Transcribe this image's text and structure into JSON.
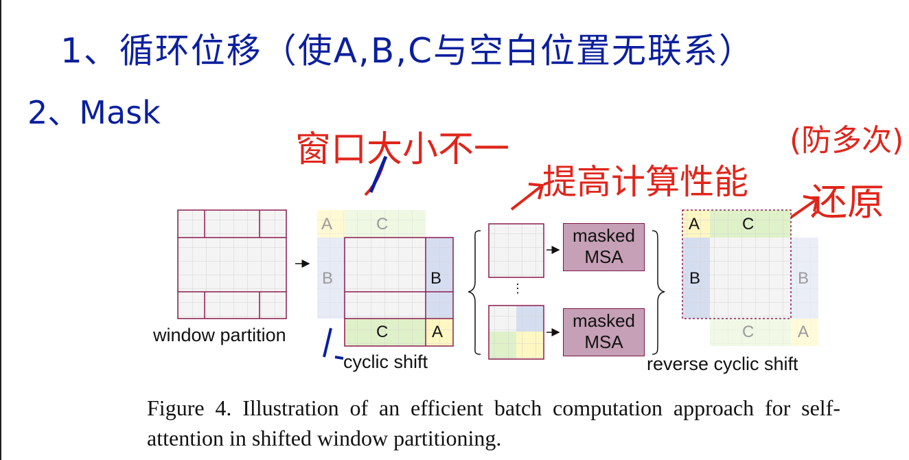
{
  "annotations": {
    "line1": "1、循环位移（使A,B,C与空白位置无联系）",
    "line2": "2、Mask",
    "window_size_note": "窗口大小不一",
    "performance_note": "提高计算性能",
    "prevent_note": "(防多次)",
    "restore_note": "还原"
  },
  "figure": {
    "window_partition_label": "window partition",
    "cyclic_shift_label": "cyclic shift",
    "reverse_cyclic_shift_label": "reverse cyclic shift",
    "letters": {
      "a": "A",
      "b": "B",
      "c": "C"
    },
    "msa_top_line1": "masked",
    "msa_top_line2": "MSA",
    "msa_bottom_line1": "masked",
    "msa_bottom_line2": "MSA",
    "vertical_dots": "⋮",
    "colors": {
      "grid_line": "#cfcfcf",
      "window_border": "#8a1a4f",
      "region_a": "#fff7c2",
      "region_b": "#d5def0",
      "region_c": "#dff1c8",
      "msa_fill": "#c6a0b6",
      "annotation_blue": "#0b1f9e",
      "annotation_red": "#e0251b"
    }
  },
  "caption": {
    "text": "Figure 4. Illustration of an efficient batch computation approach for self-attention in shifted window partitioning."
  }
}
